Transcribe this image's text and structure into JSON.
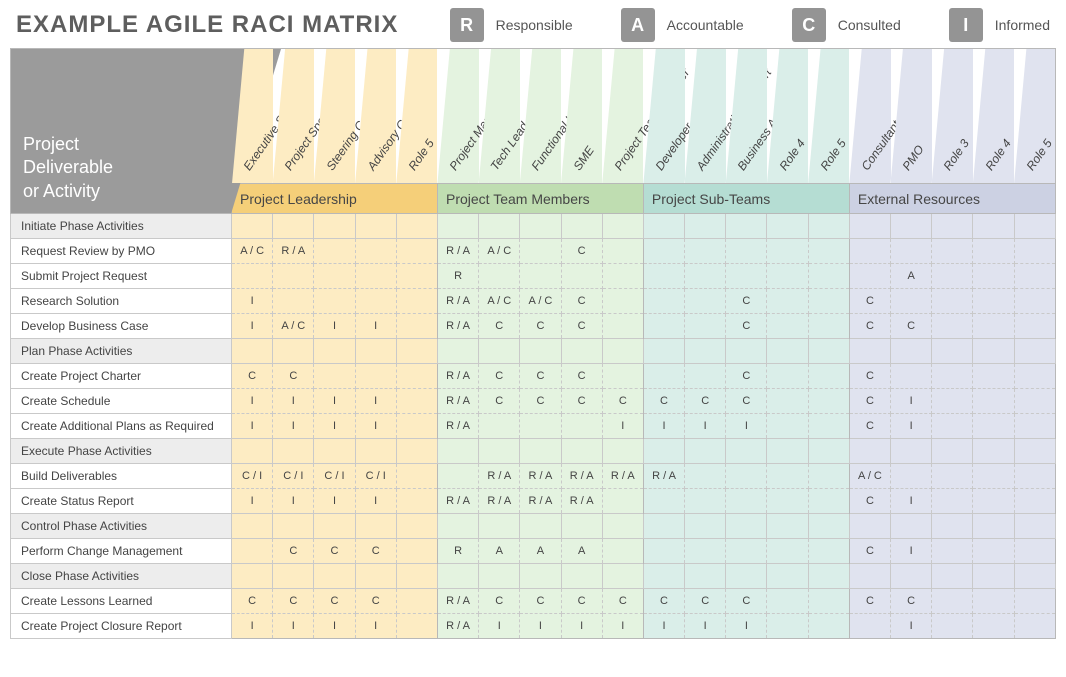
{
  "title": "EXAMPLE AGILE RACI MATRIX",
  "legend": [
    {
      "code": "R",
      "label": "Responsible"
    },
    {
      "code": "A",
      "label": "Accountable"
    },
    {
      "code": "C",
      "label": "Consulted"
    },
    {
      "code": "I",
      "label": "Informed"
    }
  ],
  "corner_label_1": "Project",
  "corner_label_2": "Deliverable",
  "corner_label_3": "or Activity",
  "groups": [
    {
      "name": "Project Leadership",
      "roles": [
        "Executive Sponsor",
        "Project Sponsor",
        "Steering Committee",
        "Advisory Committee",
        "Role 5"
      ]
    },
    {
      "name": "Project Team Members",
      "roles": [
        "Project Manager",
        "Tech Lead",
        "Functional Lead",
        "SME",
        "Project Team Manager"
      ]
    },
    {
      "name": "Project Sub-Teams",
      "roles": [
        "Developer",
        "Administrative Support",
        "Business Analyst",
        "Role 4",
        "Role 5"
      ]
    },
    {
      "name": "External Resources",
      "roles": [
        "Consultant",
        "PMO",
        "Role 3",
        "Role 4",
        "Role 5"
      ]
    }
  ],
  "rows": [
    {
      "phase": true,
      "label": "Initiate Phase Activities",
      "cells": [
        "",
        "",
        "",
        "",
        "",
        "",
        "",
        "",
        "",
        "",
        "",
        "",
        "",
        "",
        "",
        "",
        "",
        "",
        "",
        ""
      ]
    },
    {
      "label": "Request Review by PMO",
      "cells": [
        "A / C",
        "R / A",
        "",
        "",
        "",
        "R / A",
        "A / C",
        "",
        "C",
        "",
        "",
        "",
        "",
        "",
        "",
        "",
        "",
        "",
        "",
        ""
      ]
    },
    {
      "label": "Submit Project Request",
      "cells": [
        "",
        "",
        "",
        "",
        "",
        "R",
        "",
        "",
        "",
        "",
        "",
        "",
        "",
        "",
        "",
        "",
        "A",
        "",
        "",
        ""
      ]
    },
    {
      "label": "Research Solution",
      "cells": [
        "I",
        "",
        "",
        "",
        "",
        "R / A",
        "A / C",
        "A / C",
        "C",
        "",
        "",
        "",
        "C",
        "",
        "",
        "C",
        "",
        "",
        "",
        ""
      ]
    },
    {
      "label": "Develop Business Case",
      "cells": [
        "I",
        "A / C",
        "I",
        "I",
        "",
        "R / A",
        "C",
        "C",
        "C",
        "",
        "",
        "",
        "C",
        "",
        "",
        "C",
        "C",
        "",
        "",
        ""
      ]
    },
    {
      "phase": true,
      "label": "Plan Phase Activities",
      "cells": [
        "",
        "",
        "",
        "",
        "",
        "",
        "",
        "",
        "",
        "",
        "",
        "",
        "",
        "",
        "",
        "",
        "",
        "",
        "",
        ""
      ]
    },
    {
      "label": "Create Project Charter",
      "cells": [
        "C",
        "C",
        "",
        "",
        "",
        "R / A",
        "C",
        "C",
        "C",
        "",
        "",
        "",
        "C",
        "",
        "",
        "C",
        "",
        "",
        "",
        ""
      ]
    },
    {
      "label": "Create Schedule",
      "cells": [
        "I",
        "I",
        "I",
        "I",
        "",
        "R / A",
        "C",
        "C",
        "C",
        "C",
        "C",
        "C",
        "C",
        "",
        "",
        "C",
        "I",
        "",
        "",
        ""
      ]
    },
    {
      "label": "Create Additional Plans as Required",
      "cells": [
        "I",
        "I",
        "I",
        "I",
        "",
        "R / A",
        "",
        "",
        "",
        "I",
        "I",
        "I",
        "I",
        "",
        "",
        "C",
        "I",
        "",
        "",
        ""
      ]
    },
    {
      "phase": true,
      "label": "Execute Phase Activities",
      "cells": [
        "",
        "",
        "",
        "",
        "",
        "",
        "",
        "",
        "",
        "",
        "",
        "",
        "",
        "",
        "",
        "",
        "",
        "",
        "",
        ""
      ]
    },
    {
      "label": "Build Deliverables",
      "cells": [
        "C / I",
        "C / I",
        "C / I",
        "C / I",
        "",
        "",
        "R / A",
        "R / A",
        "R / A",
        "R / A",
        "R / A",
        "",
        "",
        "",
        "",
        "A / C",
        "",
        "",
        "",
        ""
      ]
    },
    {
      "label": "Create Status Report",
      "cells": [
        "I",
        "I",
        "I",
        "I",
        "",
        "R / A",
        "R / A",
        "R / A",
        "R / A",
        "",
        "",
        "",
        "",
        "",
        "",
        "C",
        "I",
        "",
        "",
        ""
      ]
    },
    {
      "phase": true,
      "label": "Control Phase Activities",
      "cells": [
        "",
        "",
        "",
        "",
        "",
        "",
        "",
        "",
        "",
        "",
        "",
        "",
        "",
        "",
        "",
        "",
        "",
        "",
        "",
        ""
      ]
    },
    {
      "label": "Perform Change Management",
      "cells": [
        "",
        "C",
        "C",
        "C",
        "",
        "R",
        "A",
        "A",
        "A",
        "",
        "",
        "",
        "",
        "",
        "",
        "C",
        "I",
        "",
        "",
        ""
      ]
    },
    {
      "phase": true,
      "label": "Close Phase Activities",
      "cells": [
        "",
        "",
        "",
        "",
        "",
        "",
        "",
        "",
        "",
        "",
        "",
        "",
        "",
        "",
        "",
        "",
        "",
        "",
        "",
        ""
      ]
    },
    {
      "label": "Create Lessons Learned",
      "cells": [
        "C",
        "C",
        "C",
        "C",
        "",
        "R / A",
        "C",
        "C",
        "C",
        "C",
        "C",
        "C",
        "C",
        "",
        "",
        "C",
        "C",
        "",
        "",
        ""
      ]
    },
    {
      "label": "Create Project Closure Report",
      "cells": [
        "I",
        "I",
        "I",
        "I",
        "",
        "R / A",
        "I",
        "I",
        "I",
        "I",
        "I",
        "I",
        "I",
        "",
        "",
        "",
        "I",
        "",
        "",
        ""
      ]
    }
  ]
}
